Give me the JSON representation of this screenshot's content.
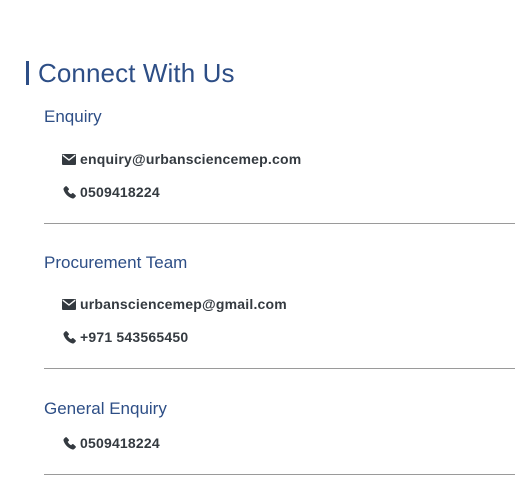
{
  "page": {
    "title": "Connect With Us",
    "accent_color": "#2d4e86",
    "text_color": "#343a40"
  },
  "sections": [
    {
      "heading": "Enquiry",
      "rows": [
        {
          "icon": "envelope-icon",
          "text": "enquiry@urbansciencemep.com"
        },
        {
          "icon": "phone-icon",
          "text": "0509418224"
        }
      ]
    },
    {
      "heading": "Procurement Team",
      "rows": [
        {
          "icon": "envelope-icon",
          "text": "urbansciencemep@gmail.com"
        },
        {
          "icon": "phone-icon",
          "text": "+971 543565450"
        }
      ]
    },
    {
      "heading": "General Enquiry",
      "rows": [
        {
          "icon": "phone-icon",
          "text": "0509418224"
        }
      ]
    }
  ]
}
